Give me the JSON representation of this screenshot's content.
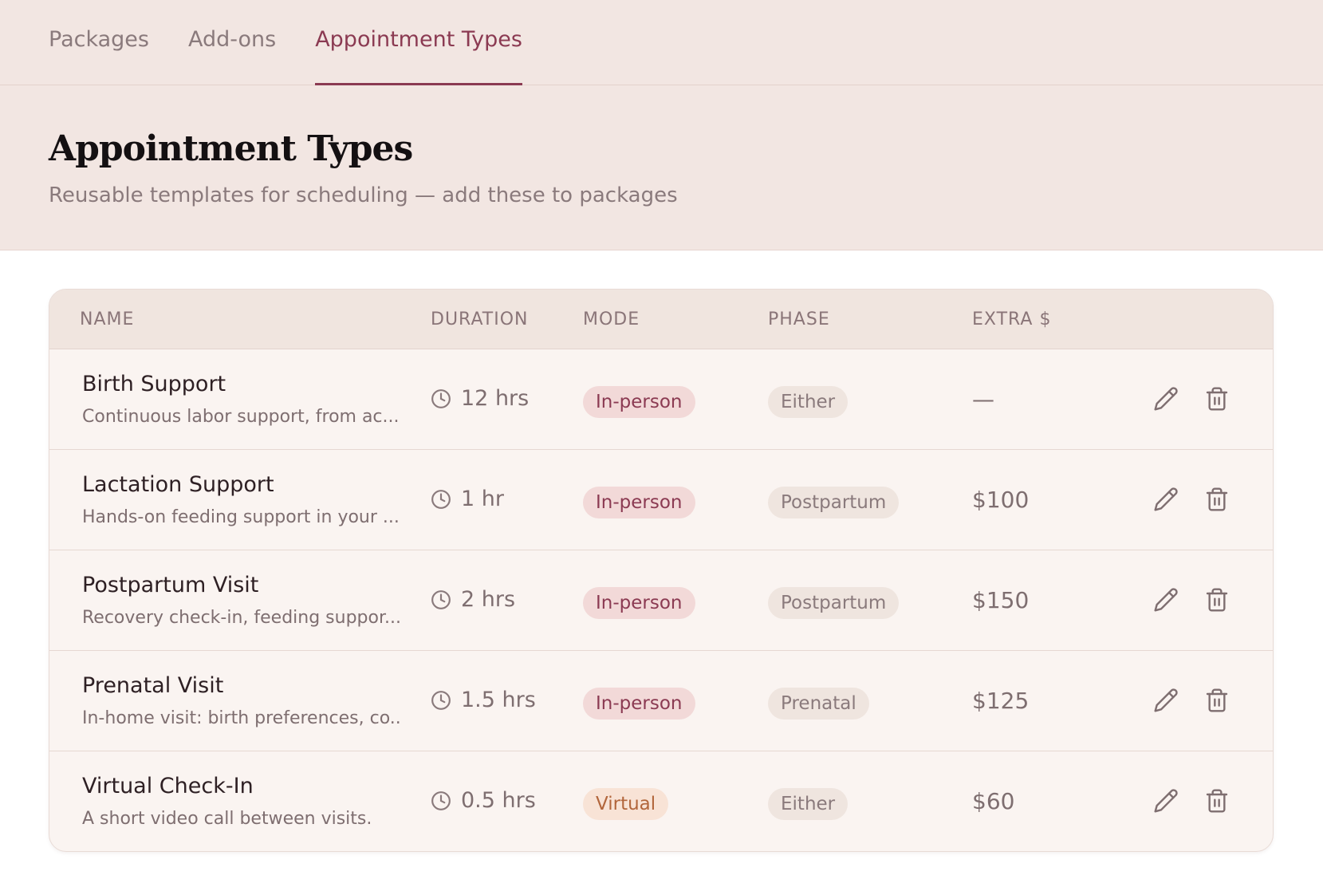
{
  "tabs": [
    {
      "label": "Packages"
    },
    {
      "label": "Add-ons"
    },
    {
      "label": "Appointment Types"
    }
  ],
  "active_tab": "Appointment Types",
  "page": {
    "title": "Appointment Types",
    "subtitle": "Reusable templates for scheduling — add these to packages"
  },
  "table": {
    "columns": [
      "NAME",
      "DURATION",
      "MODE",
      "PHASE",
      "EXTRA $"
    ],
    "rows": [
      {
        "name": "Birth Support",
        "description": "Continuous labor support, from ac...",
        "duration": "12 hrs",
        "mode": "In-person",
        "phase": "Either",
        "extra": "—"
      },
      {
        "name": "Lactation Support",
        "description": "Hands-on feeding support in your ...",
        "duration": "1 hr",
        "mode": "In-person",
        "phase": "Postpartum",
        "extra": "$100"
      },
      {
        "name": "Postpartum Visit",
        "description": "Recovery check-in, feeding suppor...",
        "duration": "2 hrs",
        "mode": "In-person",
        "phase": "Postpartum",
        "extra": "$150"
      },
      {
        "name": "Prenatal Visit",
        "description": "In-home visit: birth preferences, co...",
        "duration": "1.5 hrs",
        "mode": "In-person",
        "phase": "Prenatal",
        "extra": "$125"
      },
      {
        "name": "Virtual Check-In",
        "description": "A short video call between visits.",
        "duration": "0.5 hrs",
        "mode": "Virtual",
        "phase": "Either",
        "extra": "$60"
      }
    ]
  },
  "icons": {
    "duration": "clock-icon",
    "edit": "pencil-icon",
    "delete": "trash-icon"
  },
  "colors": {
    "accent": "#8b3a52",
    "header_bg": "#f2e6e2",
    "mode_inperson_bg": "#f2d9d8",
    "mode_virtual_bg": "#f8e3d6",
    "mode_virtual_text": "#b2663c"
  }
}
